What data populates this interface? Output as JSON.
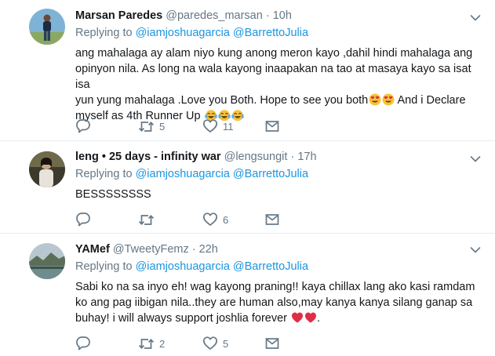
{
  "icons": {
    "reply": "reply-icon",
    "retweet": "retweet-icon",
    "like": "heart-icon",
    "dm": "envelope-icon",
    "more": "chevron-down-icon"
  },
  "colors": {
    "link": "#1b95e0",
    "secondary": "#657786",
    "divider": "#e6ecf0",
    "heart_emoji": "#dd2e44"
  },
  "tweets": [
    {
      "name": "Marsan Paredes",
      "handle": "@paredes_marsan",
      "dot": "·",
      "time": "10h",
      "replying_to_label": "Replying to",
      "replying_to_users": "@iamjoshuagarcia @BarrettoJulia",
      "lines": [
        "ang mahalaga ay alam niyo kung anong meron kayo ,dahil hindi mahalaga ang",
        "opinyon nila. As long na wala kayong inaapakan na tao at masaya kayo sa isat isa",
        "yun yung mahalaga .Love you Both. Hope to see you both",
        " And i Declare",
        "myself as 4th Runner Up"
      ],
      "emojis": [
        "heart-eyes-emoji",
        "heart-eyes-emoji",
        "tears-of-joy-emoji",
        "tears-of-joy-emoji",
        "tears-of-joy-emoji"
      ],
      "retweets": "5",
      "likes": "11"
    },
    {
      "name": "leng • 25 days - infinity war",
      "handle": "@lengsungit",
      "dot": "·",
      "time": "17h",
      "replying_to_label": "Replying to",
      "replying_to_users": "@iamjoshuagarcia @BarrettoJulia",
      "lines": [
        "BESSSSSSSS"
      ],
      "likes": "6"
    },
    {
      "name": "YAMef",
      "handle": "@TweetyFemz",
      "dot": "·",
      "time": "22h",
      "replying_to_label": "Replying to",
      "replying_to_users": "@iamjoshuagarcia @BarrettoJulia",
      "lines": [
        "Sabi ko na sa inyo eh! wag kayong praning!! kaya chillax lang ako kasi ramdam",
        "ko ang pag iibigan nila..they are human also,may kanya kanya silang ganap sa",
        "buhay! i will always support joshlia forever",
        "."
      ],
      "emojis": [
        "red-heart-emoji",
        "red-heart-emoji"
      ],
      "retweets": "2",
      "likes": "5"
    }
  ]
}
